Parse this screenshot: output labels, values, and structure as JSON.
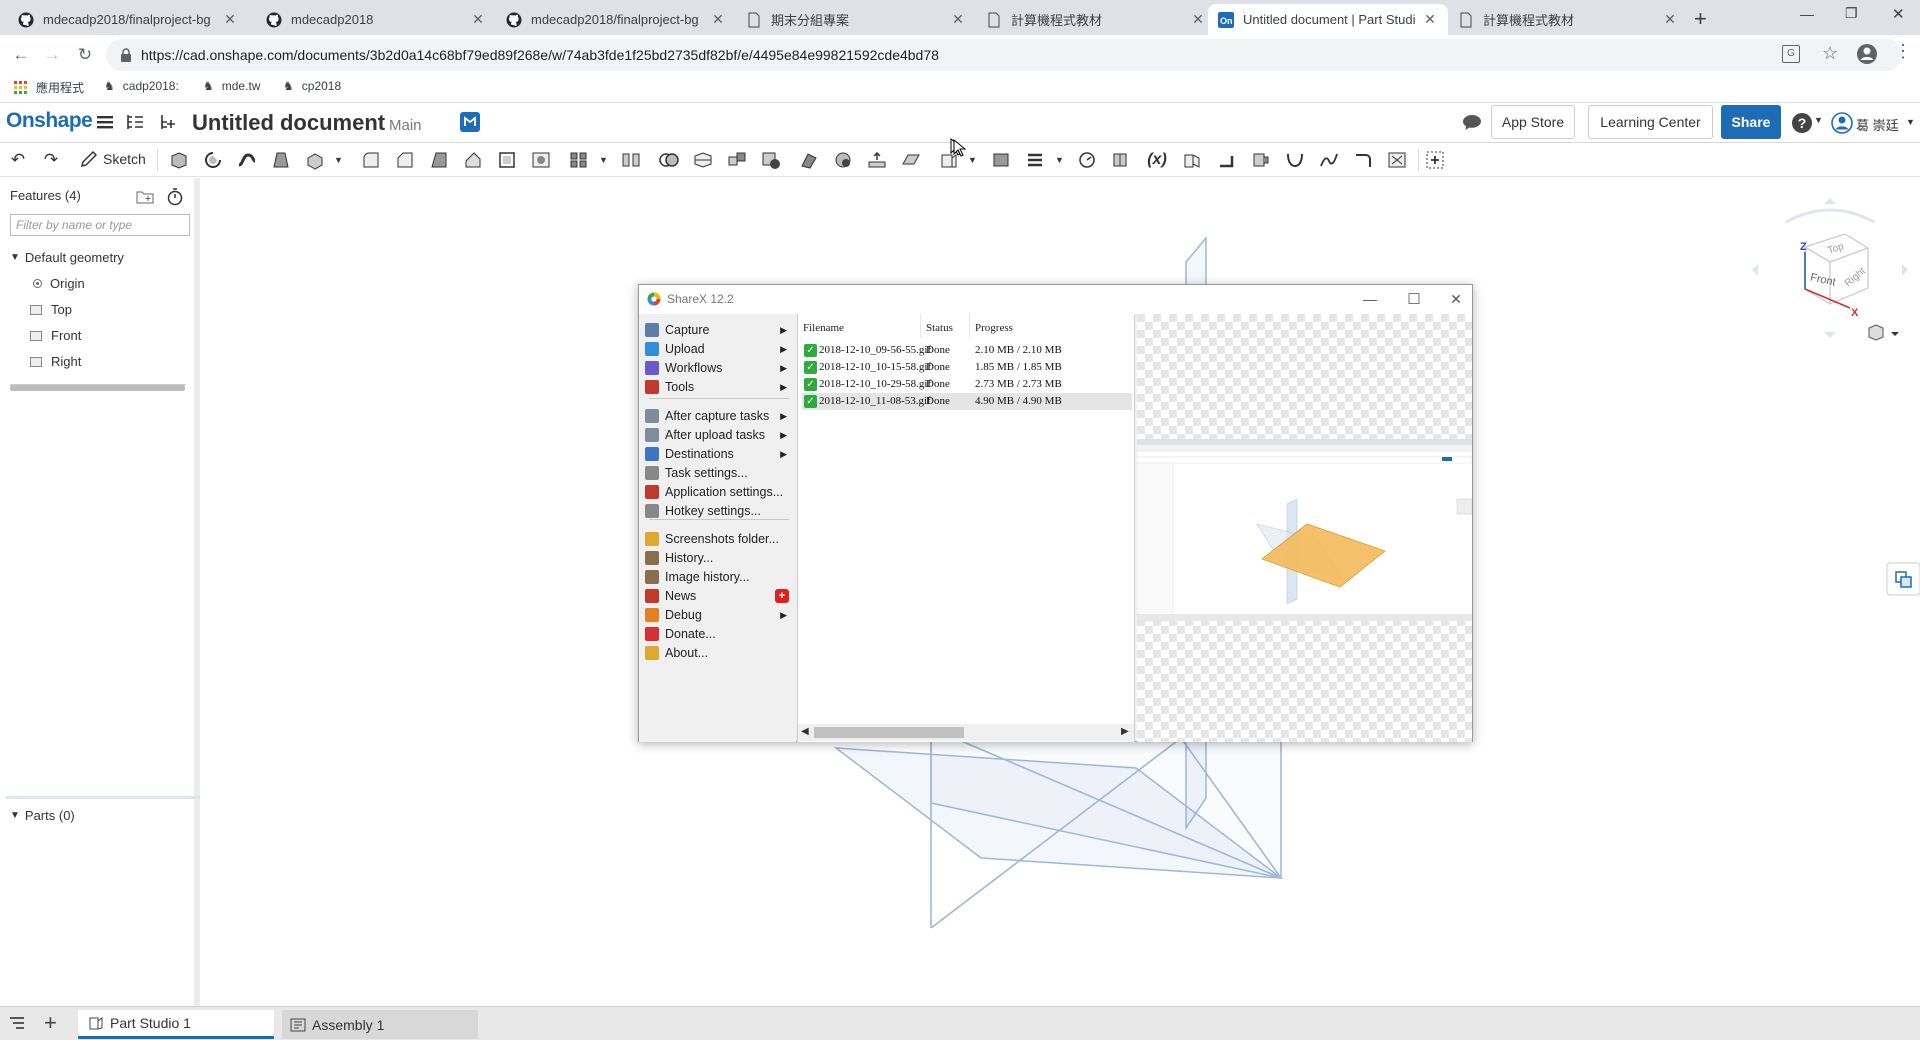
{
  "browser": {
    "tabs": [
      {
        "title": "mdecadp2018/finalproject-bg",
        "icon": "github-icon",
        "active": false
      },
      {
        "title": "mdecadp2018",
        "icon": "github-icon",
        "active": false
      },
      {
        "title": "mdecadp2018/finalproject-bg",
        "icon": "github-icon",
        "active": false
      },
      {
        "title": "期末分組專案",
        "icon": "doc-icon",
        "active": false
      },
      {
        "title": "計算機程式教材",
        "icon": "doc-icon",
        "active": false
      },
      {
        "title": "Untitled document | Part Studi",
        "icon": "onshape-icon",
        "active": true
      },
      {
        "title": "計算機程式教材",
        "icon": "doc-icon",
        "active": false
      }
    ],
    "url": "https://cad.onshape.com/documents/3b2d0a14c68bf79ed89f268e/w/74ab3fde1f25bd2735df82bf/e/4495e84e99821592cde4bd78",
    "bookmarks": [
      "應用程式",
      "cadp2018:",
      "mde.tw",
      "cp2018"
    ]
  },
  "onshape": {
    "logo": "Onshape",
    "doc_title": "Untitled document",
    "branch": "Main",
    "app_store": "App Store",
    "learning_center": "Learning Center",
    "share": "Share",
    "user": "葛 崇廷",
    "sketch_label": "Sketch",
    "features_title": "Features (4)",
    "filter_placeholder": "Filter by name or type",
    "default_geometry": "Default geometry",
    "tree_items": [
      "Origin",
      "Top",
      "Front",
      "Right"
    ],
    "parts_title": "Parts (0)",
    "bottom_tabs": [
      "Part Studio 1",
      "Assembly 1"
    ],
    "viewcube": {
      "top": "Top",
      "front": "Front",
      "right": "Right",
      "z": "Z",
      "x": "X"
    }
  },
  "sharex": {
    "title": "ShareX 12.2",
    "menu": [
      {
        "label": "Capture",
        "icon": "capture-icon",
        "submenu": true,
        "color": "#5b7fa8"
      },
      {
        "label": "Upload",
        "icon": "upload-icon",
        "submenu": true,
        "color": "#2f8fd8"
      },
      {
        "label": "Workflows",
        "icon": "workflows-icon",
        "submenu": true,
        "color": "#6a5acd"
      },
      {
        "label": "Tools",
        "icon": "tools-icon",
        "submenu": true,
        "color": "#c0392b"
      },
      {
        "label": "After capture tasks",
        "icon": "after-capture-icon",
        "submenu": true,
        "color": "#7f8c9a"
      },
      {
        "label": "After upload tasks",
        "icon": "after-upload-icon",
        "submenu": true,
        "color": "#7f8c9a"
      },
      {
        "label": "Destinations",
        "icon": "destinations-icon",
        "submenu": true,
        "color": "#3a76c4"
      },
      {
        "label": "Task settings...",
        "icon": "task-settings-icon",
        "submenu": false,
        "color": "#888888"
      },
      {
        "label": "Application settings...",
        "icon": "app-settings-icon",
        "submenu": false,
        "color": "#c0392b"
      },
      {
        "label": "Hotkey settings...",
        "icon": "hotkey-icon",
        "submenu": false,
        "color": "#888888"
      },
      {
        "label": "Screenshots folder...",
        "icon": "folder-icon",
        "submenu": false,
        "color": "#e0a82e"
      },
      {
        "label": "History...",
        "icon": "history-icon",
        "submenu": false,
        "color": "#8a6d4b"
      },
      {
        "label": "Image history...",
        "icon": "image-history-icon",
        "submenu": false,
        "color": "#8a6d4b"
      },
      {
        "label": "News",
        "icon": "news-icon",
        "submenu": false,
        "color": "#c0392b",
        "badge": "+"
      },
      {
        "label": "Debug",
        "icon": "debug-icon",
        "submenu": true,
        "color": "#e67e22"
      },
      {
        "label": "Donate...",
        "icon": "heart-icon",
        "submenu": false,
        "color": "#d63031"
      },
      {
        "label": "About...",
        "icon": "about-icon",
        "submenu": false,
        "color": "#e0a82e"
      }
    ],
    "columns": [
      "Filename",
      "Status",
      "Progress"
    ],
    "rows": [
      {
        "filename": "2018-12-10_09-56-55.gif",
        "status": "Done",
        "progress": "2.10 MB / 2.10 MB"
      },
      {
        "filename": "2018-12-10_10-15-58.gif",
        "status": "Done",
        "progress": "1.85 MB / 1.85 MB"
      },
      {
        "filename": "2018-12-10_10-29-58.gif",
        "status": "Done",
        "progress": "2.73 MB / 2.73 MB"
      },
      {
        "filename": "2018-12-10_11-08-53.gif",
        "status": "Done",
        "progress": "4.90 MB / 4.90 MB"
      }
    ]
  },
  "colors": {
    "onshape_blue": "#1f6cb6",
    "plane": "#9bb8d8",
    "preview_plane": "#f4b95a",
    "done_green": "#2faa3c"
  }
}
